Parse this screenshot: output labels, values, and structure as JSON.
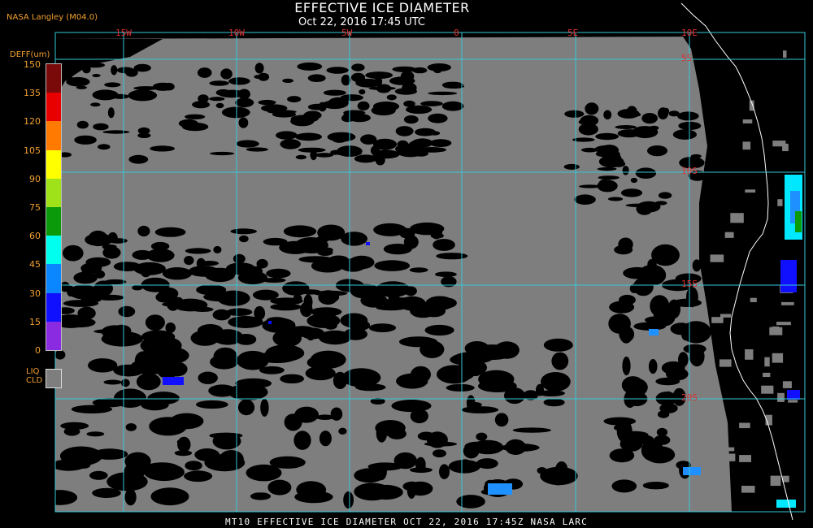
{
  "header": {
    "title": "EFFECTIVE ICE DIAMETER",
    "subtitle": "Oct 22, 2016 17:45 UTC",
    "credit": "NASA Langley (M04.0)"
  },
  "legend": {
    "title": "DEFF(um)",
    "scale_labels": [
      "150",
      "135",
      "120",
      "105",
      "90",
      "75",
      "60",
      "45",
      "30",
      "15",
      "0"
    ],
    "colors_top_to_bottom": [
      "#7a0a0a",
      "#e80000",
      "#ff7a00",
      "#ffff00",
      "#9fe21a",
      "#0a9a0a",
      "#00ffee",
      "#0a86ff",
      "#1010ff",
      "#8a2be2"
    ],
    "liq_label_line1": "LIQ",
    "liq_label_line2": "CLD",
    "liq_color": "#7e7e7e"
  },
  "grid": {
    "longitude_labels": [
      "15W",
      "10W",
      "5W",
      "0",
      "5E",
      "10E"
    ],
    "latitude_labels": [
      "5S",
      "10S",
      "15S",
      "20S"
    ],
    "line_color": "#35c8d8"
  },
  "footer": {
    "text": "MT10  EFFECTIVE ICE DIAMETER  OCT 22, 2016 17:45Z  NASA LARC"
  },
  "colors": {
    "background": "#000000",
    "liquid_cloud": "#7e7e7e",
    "coastline": "#ffffff",
    "label_accent": "#f0a030",
    "grid_label": "#e03030"
  }
}
